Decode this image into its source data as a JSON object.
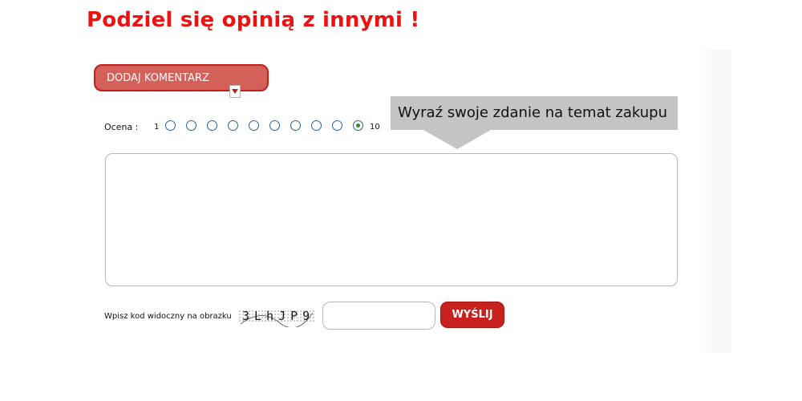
{
  "page": {
    "title": "Podziel się opinią z innymi !"
  },
  "comment_form": {
    "add_comment_label": "DODAJ KOMENTARZ",
    "rating": {
      "label": "Ocena :",
      "min_label": "1",
      "max_label": "10",
      "selected": 10
    },
    "tooltip_text": "Wyraź swoje zdanie na temat zakupu",
    "comment_value": "",
    "captcha": {
      "label": "Wpisz kod widoczny na obrazku",
      "image_text": "3LhJP9",
      "input_value": ""
    },
    "send_label": "WYŚLIJ"
  },
  "colors": {
    "title": "#ee1111",
    "add_button_bg": "#d4605a",
    "add_button_border": "#c41f1f",
    "send_button_bg": "#c9211e",
    "tooltip_bg": "#c4c4c4",
    "radio_border": "#2f5f9a",
    "radio_selected": "#2e8b2e"
  },
  "icons": {
    "dropdown": "chevron-down-icon"
  }
}
